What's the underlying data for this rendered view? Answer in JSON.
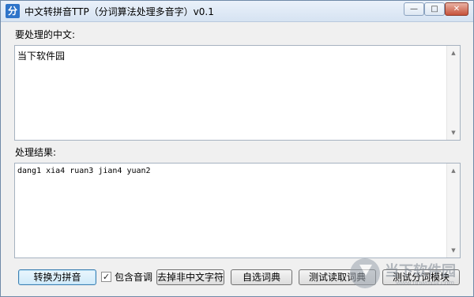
{
  "window": {
    "app_icon": "分",
    "title": "中文转拼音TTP（分词算法处理多音字）v0.1",
    "controls": {
      "minimize": "—",
      "maximize": "□",
      "close": "✕"
    }
  },
  "input": {
    "label": "要处理的中文:",
    "value": "当下软件园"
  },
  "output": {
    "label": "处理结果:",
    "value": "dang1 xia4 ruan3 jian4 yuan2"
  },
  "actions": {
    "convert": "转换为拼音",
    "include_tones_label": "包含音调",
    "include_tones_checked": true,
    "remove_non_chinese": "去掉非中文字符",
    "choose_dictionary": "自选词典",
    "test_read_dictionary": "测试读取词典",
    "test_segmentation": "测试分词模块"
  },
  "watermark": {
    "text": "当下软件园",
    "url": "www.downxia.com"
  }
}
